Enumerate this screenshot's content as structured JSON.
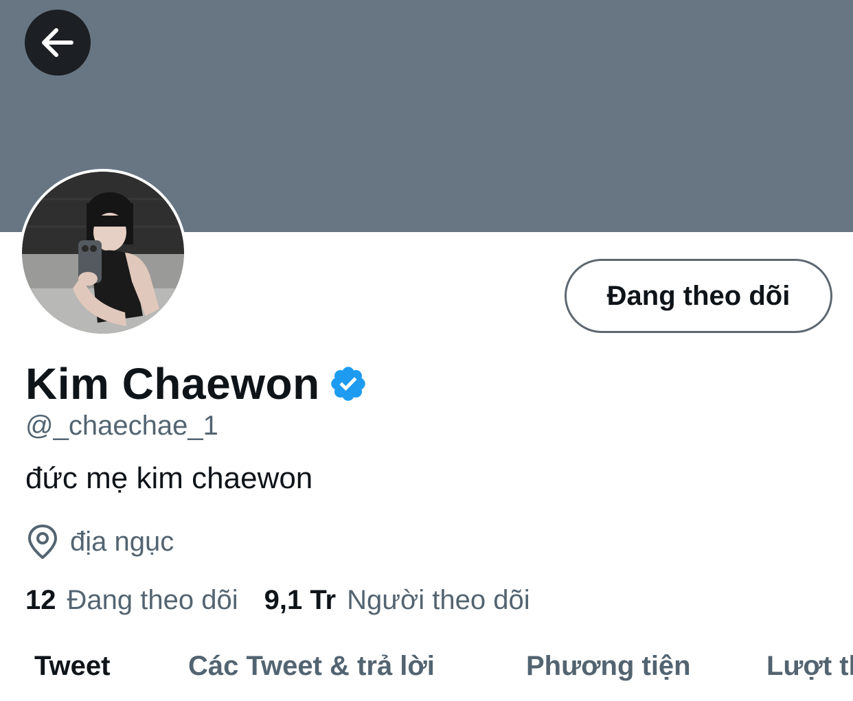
{
  "banner": {
    "color": "#687684"
  },
  "back_button": {
    "icon": "arrow-left-icon"
  },
  "follow_button": {
    "label": "Đang theo dõi"
  },
  "profile": {
    "display_name": "Kim Chaewon",
    "verified_icon": "verified-badge-icon",
    "handle": "@_chaechae_1",
    "bio": "đức mẹ kim chaewon",
    "location": "địa ngục",
    "location_icon": "location-pin-icon"
  },
  "stats": {
    "following_count": "12",
    "following_label": "Đang theo dõi",
    "followers_count": "9,1 Tr",
    "followers_label": "Người theo dõi"
  },
  "tabs": [
    {
      "label": "Tweet",
      "active": true
    },
    {
      "label": "Các Tweet & trả lời",
      "active": false
    },
    {
      "label": "Phương tiện",
      "active": false
    },
    {
      "label": "Lượt thích",
      "active": false
    }
  ],
  "colors": {
    "primary_text": "#0f1419",
    "secondary_text": "#536471",
    "verified": "#1d9bf0",
    "back_button_bg": "#1c1f23"
  }
}
